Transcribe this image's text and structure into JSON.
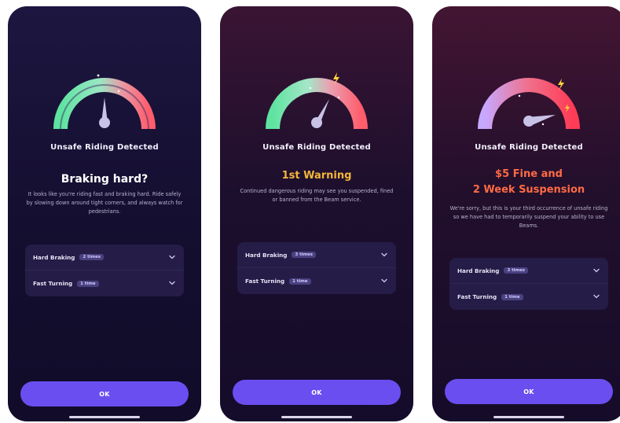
{
  "screens": [
    {
      "title": "Unsafe Riding Detected",
      "heading": "Braking hard?",
      "body": "It looks like you're riding fast and braking hard. Ride safely by slowing down around tight corners, and always watch for pedestrians.",
      "rows": [
        {
          "label": "Hard Braking",
          "badge": "2 times"
        },
        {
          "label": "Fast Turning",
          "badge": "1 time"
        }
      ],
      "ok_label": "OK"
    },
    {
      "title": "Unsafe Riding Detected",
      "heading": "1st Warning",
      "body": "Continued dangerous riding may see you suspended, fined or banned from the Beam service.",
      "rows": [
        {
          "label": "Hard Braking",
          "badge": "3 times"
        },
        {
          "label": "Fast Turning",
          "badge": "1 time"
        }
      ],
      "ok_label": "OK"
    },
    {
      "title": "Unsafe Riding Detected",
      "heading": "$5 Fine and",
      "heading_line2": "2 Week Suspension",
      "body": "We're sorry, but this is your third occurrence of unsafe riding so we have had to temporarily suspend your ability to use Beams.",
      "rows": [
        {
          "label": "Hard Braking",
          "badge": "3 times"
        },
        {
          "label": "Fast Turning",
          "badge": "1 time"
        }
      ],
      "ok_label": "OK"
    }
  ],
  "colors": {
    "accent": "#6a4ef0",
    "warning": "#f5b63a",
    "danger": "#ff6a45"
  },
  "icons": {
    "gauge": "speedometer-icon",
    "chevron": "chevron-down-icon",
    "spark": "lightning-icon"
  }
}
